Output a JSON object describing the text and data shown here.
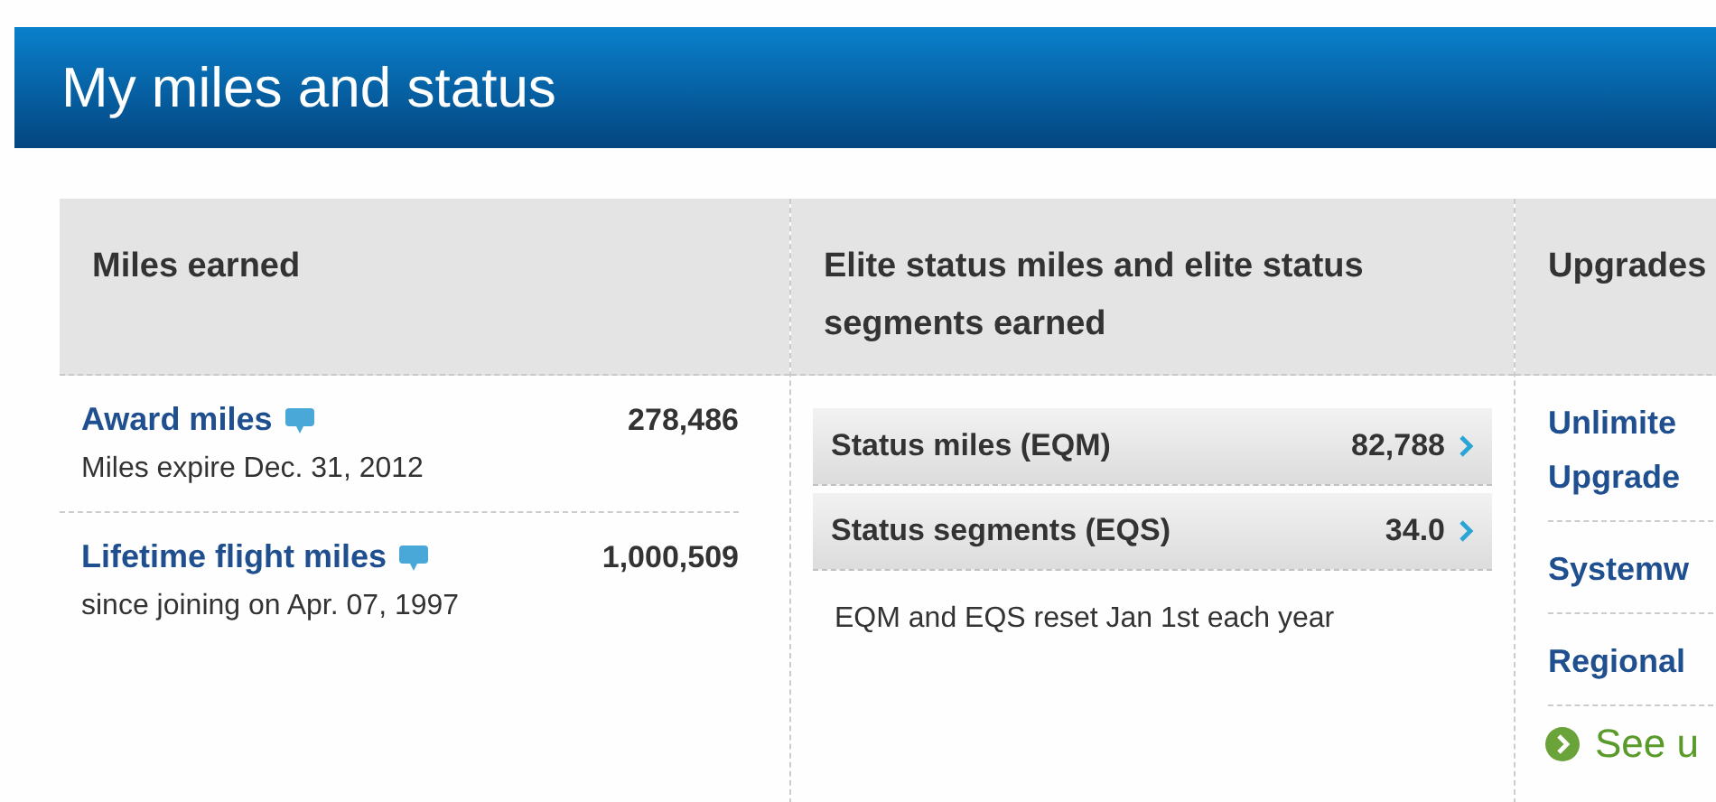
{
  "header": {
    "title": "My miles and status"
  },
  "columns": [
    {
      "heading": "Miles earned",
      "kind": "miles",
      "items": [
        {
          "label": "Award miles",
          "value": "278,486",
          "note": "Miles expire Dec. 31, 2012"
        },
        {
          "label": "Lifetime flight miles",
          "value": "1,000,509",
          "note": "since joining on Apr. 07, 1997"
        }
      ]
    },
    {
      "heading": "Elite status miles and elite status segments earned",
      "kind": "status",
      "items": [
        {
          "label": "Status miles (EQM)",
          "value": "82,788"
        },
        {
          "label": "Status segments (EQS)",
          "value": "34.0"
        }
      ],
      "note": "EQM and EQS reset Jan 1st each year"
    },
    {
      "heading": "Upgrades",
      "kind": "upgrades",
      "items": [
        {
          "label": "Unlimite\nUpgrade"
        },
        {
          "label": "Systemw"
        },
        {
          "label": "Regional"
        }
      ],
      "action": "See u"
    }
  ]
}
